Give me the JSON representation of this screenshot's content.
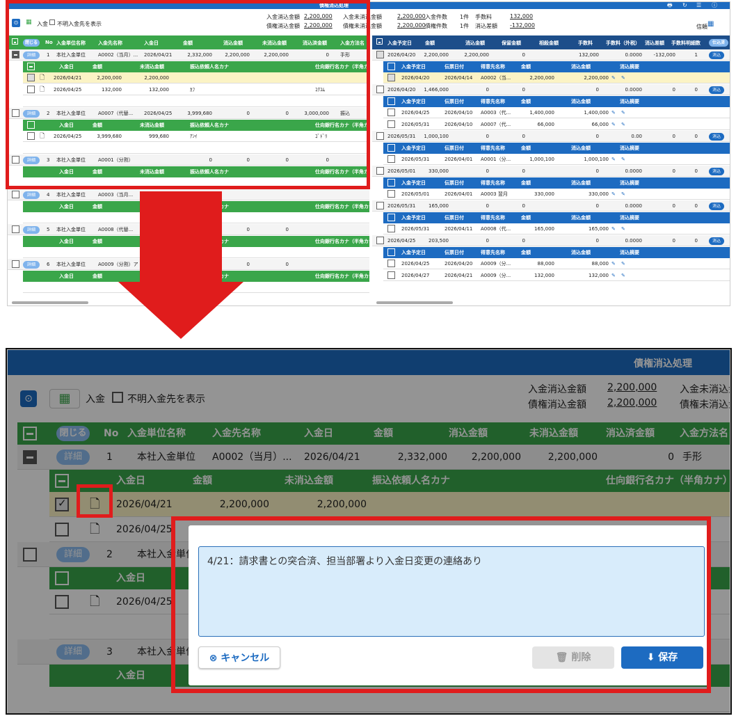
{
  "screen_title": "債権消込処理",
  "toolbar": {
    "deposit_label": "入金",
    "unknown_label": "不明入金先を表示",
    "deposit_clear_label": "入金消込金額",
    "deposit_clear_value": "2,200,000",
    "deposit_unclear_label": "入金未消込金額",
    "deposit_unclear_value": "2,200,000",
    "claim_clear_label": "債権消込金額",
    "claim_clear_value": "2,200,000",
    "claim_unclear_label": "債権未消込金額",
    "claim_unclear_value": "2,200,000",
    "deposit_count_label": "入金件数",
    "deposit_count_value": "1件",
    "claim_count_label": "債権件数",
    "claim_count_value": "1件",
    "fee_label": "手数料",
    "fee_value": "132,000",
    "diff_label": "消込差額",
    "diff_value": "-132,000",
    "trust_label": "信頼"
  },
  "left_header": {
    "close": "閉じる",
    "cols": [
      "No",
      "入金単位名称",
      "入金先名称",
      "入金日",
      "金額",
      "消込金額",
      "未消込金額",
      "消込済金額",
      "入金方法名"
    ]
  },
  "left_sub_header": {
    "cols": [
      "入金日",
      "金額",
      "未消込金額",
      "振込依頼人名カナ",
      "仕向銀行名カナ（半角カナ）"
    ]
  },
  "right_header": {
    "cols": [
      "入金予定日",
      "金額",
      "消込金額",
      "保留金額",
      "相殺金額",
      "手数料",
      "手数料（外税）",
      "消込差額",
      "手数料明細数"
    ],
    "button": "仕込済"
  },
  "right_sub_header": {
    "cols": [
      "入金予定日",
      "伝票日付",
      "得意先名称",
      "金額",
      "消込金額",
      "消込摘要"
    ]
  },
  "detail_button": "詳細",
  "clear_button": "消込",
  "left_groups": [
    {
      "no": "1",
      "unit": "本社入金単位",
      "dest": "A0002（当月）...",
      "date": "2026/04/21",
      "amount": "2,332,000",
      "clear": "2,200,000",
      "unclear": "2,200,000",
      "done": "0",
      "method": "手形",
      "subs": [
        {
          "date": "2026/04/21",
          "amount": "2,200,000",
          "unclear": "2,200,000",
          "kana": "",
          "bank": ""
        },
        {
          "date": "2026/04/25",
          "amount": "132,000",
          "unclear": "132,000",
          "kana": "ｶﾌ",
          "bank": "ｺｸﾕﾑ"
        }
      ]
    },
    {
      "no": "2",
      "unit": "本社入金単位",
      "dest": "A0007（代替...",
      "date": "2026/04/25",
      "amount": "3,999,680",
      "clear": "0",
      "unclear": "0",
      "done": "3,000,000",
      "method": "振込",
      "subs": [
        {
          "date": "2026/04/25",
          "amount": "3,999,680",
          "unclear": "999,680",
          "kana": "ｱﾝｲ",
          "bank": "ｺﾞﾄﾞﾘ"
        }
      ]
    },
    {
      "no": "3",
      "unit": "本社入金単位",
      "dest": "A0001（分割）",
      "date": "",
      "amount": "0",
      "clear": "0",
      "unclear": "0",
      "done": "0",
      "method": "",
      "subs": []
    },
    {
      "no": "4",
      "unit": "本社入金単位",
      "dest": "A0003（当月...",
      "date": "",
      "amount": "0",
      "clear": "",
      "unclear": "",
      "done": "",
      "method": "",
      "subs": []
    },
    {
      "no": "5",
      "unit": "本社入金単位",
      "dest": "A0008（代替...",
      "date": "",
      "amount": "0",
      "clear": "0",
      "unclear": "0",
      "done": "",
      "method": "",
      "subs": []
    },
    {
      "no": "6",
      "unit": "本社入金単位",
      "dest": "A0009（分割）ア",
      "date": "",
      "amount": "0",
      "clear": "0",
      "unclear": "0",
      "done": "",
      "method": "",
      "subs": []
    }
  ],
  "right_groups": [
    {
      "date": "2026/04/20",
      "amount": "2,200,000",
      "clear": "2,200,000",
      "hold": "0",
      "offset": "",
      "fee": "132,000",
      "feex": "0.0000",
      "diff": "-132,000",
      "cnt": "1",
      "subs": [
        {
          "date": "2026/04/20",
          "slip": "2026/04/14",
          "cust": "A0002（当...",
          "amount": "2,200,000",
          "clear": "2,200,000"
        }
      ]
    },
    {
      "date": "2026/04/20",
      "amount": "1,466,000",
      "clear": "0",
      "hold": "0",
      "offset": "",
      "fee": "0",
      "feex": "0.0000",
      "diff": "0",
      "cnt": "0",
      "subs": [
        {
          "date": "2026/04/25",
          "slip": "2026/04/10",
          "cust": "A0003（代...",
          "amount": "1,400,000",
          "clear": "1,400,000"
        },
        {
          "date": "2026/05/31",
          "slip": "2026/04/10",
          "cust": "A0007（代...",
          "amount": "66,000",
          "clear": "66,000"
        }
      ]
    },
    {
      "date": "2026/05/31",
      "amount": "1,000,100",
      "clear": "0",
      "hold": "0",
      "offset": "",
      "fee": "0",
      "feex": "0.00",
      "diff": "0",
      "cnt": "0",
      "subs": [
        {
          "date": "2026/05/31",
          "slip": "2026/04/01",
          "cust": "A0001（分...",
          "amount": "1,000,100",
          "clear": "1,000,100"
        }
      ]
    },
    {
      "date": "2026/05/01",
      "amount": "330,000",
      "clear": "0",
      "hold": "0",
      "offset": "",
      "fee": "0",
      "feex": "0.0000",
      "diff": "0",
      "cnt": "0",
      "subs": [
        {
          "date": "2026/05/01",
          "slip": "2026/04/01",
          "cust": "A0003 翌月",
          "amount": "330,000",
          "clear": "330,000"
        }
      ]
    },
    {
      "date": "2026/05/31",
      "amount": "165,000",
      "clear": "0",
      "hold": "0",
      "offset": "",
      "fee": "0",
      "feex": "0.0000",
      "diff": "0",
      "cnt": "0",
      "subs": [
        {
          "date": "2026/05/31",
          "slip": "2026/04/11",
          "cust": "A0008（代...",
          "amount": "165,000",
          "clear": "165,000"
        }
      ]
    },
    {
      "date": "2026/04/25",
      "amount": "203,500",
      "clear": "0",
      "hold": "0",
      "offset": "",
      "fee": "0",
      "feex": "0.0000",
      "diff": "0",
      "cnt": "0",
      "subs": [
        {
          "date": "2026/04/25",
          "slip": "2026/04/20",
          "cust": "A0009（分...",
          "amount": "88,000",
          "clear": "88,000"
        },
        {
          "date": "2026/04/27",
          "slip": "2026/04/21",
          "cust": "A0009（分...",
          "amount": "132,000",
          "clear": "132,000"
        }
      ]
    }
  ],
  "memo_dialog": {
    "text": "4/21：請求書との突合済、担当部署より入金日変更の連絡あり",
    "cancel": "キャンセル",
    "delete": "削除",
    "save": "保存"
  },
  "colors": {
    "green": "#3aa64a",
    "blue": "#1d6bc1",
    "red": "#e01c1c",
    "yellow": "#fbf3c5"
  }
}
